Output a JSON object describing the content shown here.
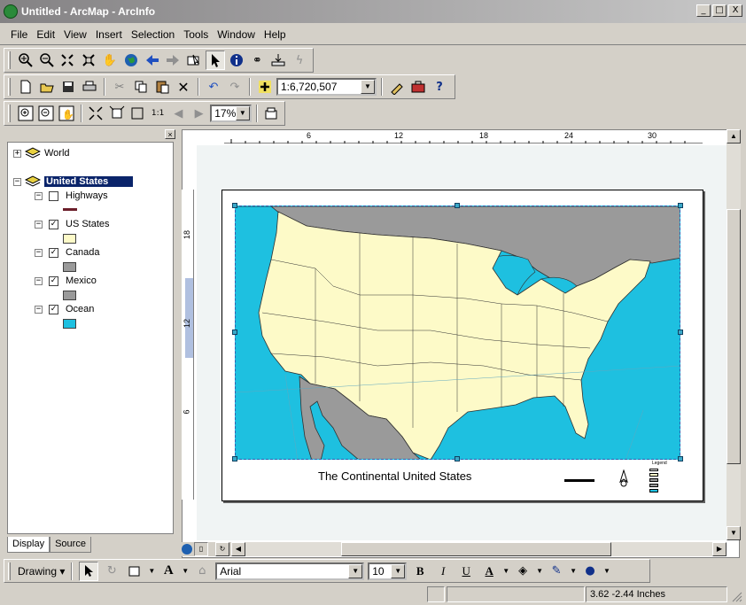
{
  "window": {
    "title": "Untitled - ArcMap - ArcInfo",
    "btn_min": "_",
    "btn_max": "□",
    "btn_close": "X"
  },
  "menu": [
    "File",
    "Edit",
    "View",
    "Insert",
    "Selection",
    "Tools",
    "Window",
    "Help"
  ],
  "toolbar_standard": {
    "scale": "1:6,720,507"
  },
  "toolbar_layout": {
    "zoom": "17%"
  },
  "toc": {
    "close": "×",
    "layers": [
      {
        "name": "World",
        "expand": "+"
      },
      {
        "name": "United States",
        "expand": "−"
      }
    ],
    "sublayers": [
      {
        "name": "Highways",
        "checked": "",
        "color": "#6b1e2a"
      },
      {
        "name": "US States",
        "checked": "✓",
        "color": "#fdfac8"
      },
      {
        "name": "Canada",
        "checked": "✓",
        "color": "#9a9a9a"
      },
      {
        "name": "Mexico",
        "checked": "✓",
        "color": "#9a9a9a"
      },
      {
        "name": "Ocean",
        "checked": "✓",
        "color": "#1ec0e0"
      }
    ],
    "tabs": [
      "Display",
      "Source"
    ]
  },
  "ruler_h": [
    "6",
    "12",
    "18",
    "24",
    "30"
  ],
  "ruler_v": [
    "18",
    "12",
    "6"
  ],
  "map": {
    "title": "The Continental United States",
    "legend_title": "Legend"
  },
  "drawing": {
    "label": "Drawing",
    "font": "Arial",
    "size": "10",
    "bold": "B",
    "italic": "I",
    "underline": "U",
    "font_color": "A"
  },
  "status": {
    "coords": "3.62  -2.44 Inches"
  }
}
